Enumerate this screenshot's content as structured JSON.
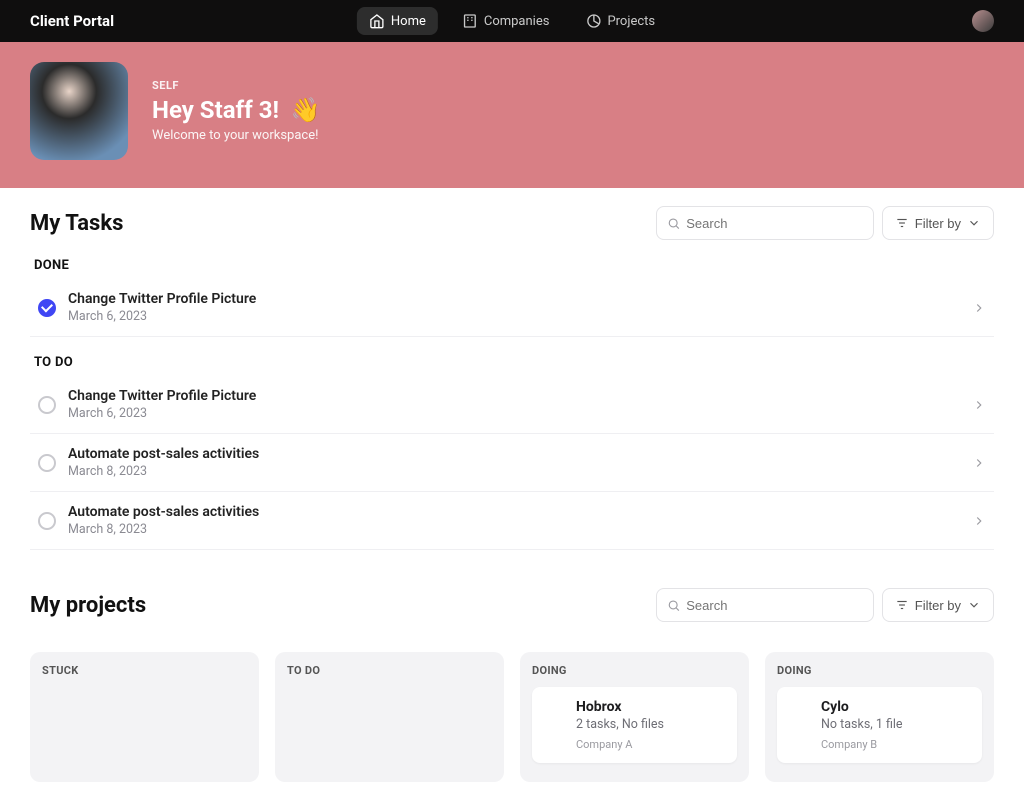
{
  "brand": "Client Portal",
  "nav": [
    {
      "label": "Home",
      "active": true
    },
    {
      "label": "Companies",
      "active": false
    },
    {
      "label": "Projects",
      "active": false
    }
  ],
  "hero": {
    "kicker": "SELF",
    "title": "Hey Staff 3!",
    "emoji": "👋",
    "subtitle": "Welcome to your workspace!"
  },
  "tasks": {
    "title": "My Tasks",
    "search_placeholder": "Search",
    "filter_label": "Filter by",
    "groups": [
      {
        "label": "DONE",
        "items": [
          {
            "title": "Change Twitter Profile Picture",
            "date": "March 6, 2023",
            "done": true
          }
        ]
      },
      {
        "label": "TO DO",
        "items": [
          {
            "title": "Change Twitter Profile Picture",
            "date": "March 6, 2023",
            "done": false
          },
          {
            "title": "Automate post-sales activities",
            "date": "March 8, 2023",
            "done": false
          },
          {
            "title": "Automate post-sales activities",
            "date": "March 8, 2023",
            "done": false
          }
        ]
      }
    ]
  },
  "projects": {
    "title": "My projects",
    "search_placeholder": "Search",
    "filter_label": "Filter by",
    "columns": [
      {
        "label": "STUCK",
        "cards": []
      },
      {
        "label": "TO DO",
        "cards": []
      },
      {
        "label": "DOING",
        "cards": [
          {
            "name": "Hobrox",
            "meta": "2 tasks, No files",
            "company": "Company A"
          }
        ]
      },
      {
        "label": "DOING",
        "cards": [
          {
            "name": "Cylo",
            "meta": "No tasks, 1 file",
            "company": "Company B"
          }
        ]
      }
    ]
  }
}
